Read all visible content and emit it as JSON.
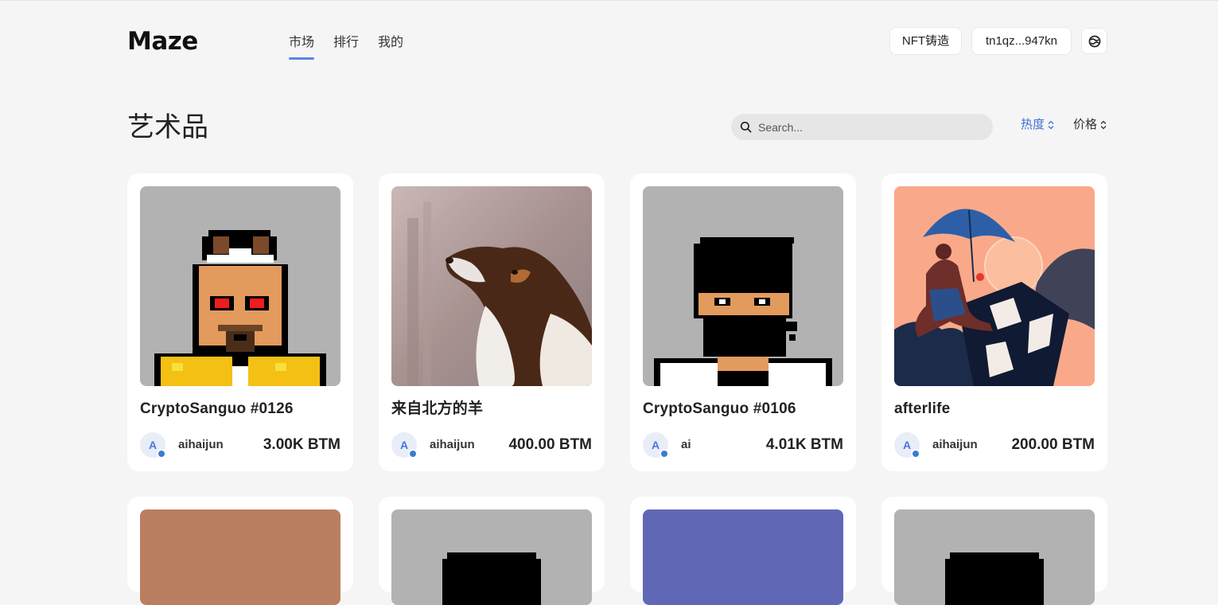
{
  "header": {
    "logo": "Maze",
    "nav": [
      {
        "label": "市场",
        "active": true
      },
      {
        "label": "排行",
        "active": false
      },
      {
        "label": "我的",
        "active": false
      }
    ],
    "mint_button": "NFT铸造",
    "wallet_button": "tn1qz...947kn",
    "lang_icon": "language-icon"
  },
  "main": {
    "title": "艺术品",
    "search_placeholder": "Search...",
    "sort": {
      "heat": "热度",
      "price": "价格"
    },
    "accent_color": "#3a6fd8"
  },
  "cards": [
    {
      "name": "CryptoSanguo #0126",
      "avatar_letter": "A",
      "owner": "aihaijun",
      "price": "3.00K BTM"
    },
    {
      "name": "来自北方的羊",
      "avatar_letter": "A",
      "owner": "aihaijun",
      "price": "400.00 BTM"
    },
    {
      "name": "CryptoSanguo #0106",
      "avatar_letter": "A",
      "owner": "ai",
      "price": "4.01K BTM"
    },
    {
      "name": "afterlife",
      "avatar_letter": "A",
      "owner": "aihaijun",
      "price": "200.00 BTM"
    }
  ]
}
